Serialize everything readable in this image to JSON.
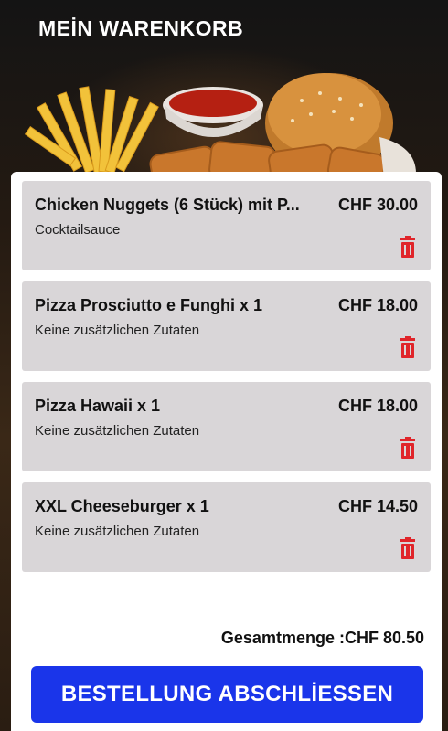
{
  "header": {
    "title": "MEİN WARENKORB"
  },
  "cart": {
    "items": [
      {
        "name": "Chicken Nuggets (6 Stück) mit P...",
        "price": "CHF 30.00",
        "note": "Cocktailsauce"
      },
      {
        "name": "Pizza Prosciutto e Funghi x 1",
        "price": "CHF 18.00",
        "note": "Keine zusätzlichen Zutaten"
      },
      {
        "name": "Pizza Hawaii x 1",
        "price": "CHF 18.00",
        "note": "Keine zusätzlichen Zutaten"
      },
      {
        "name": "XXL Cheeseburger x 1",
        "price": "CHF 14.50",
        "note": "Keine zusätzlichen Zutaten"
      }
    ],
    "total_label": "Gesamtmenge :CHF 80.50"
  },
  "actions": {
    "order_label": "BESTELLUNG ABSCHLİESSEN"
  },
  "icons": {
    "delete": "trash-icon"
  },
  "colors": {
    "accent": "#1a35ea",
    "delete": "#e0252a",
    "item_bg": "#d9d6d8"
  }
}
